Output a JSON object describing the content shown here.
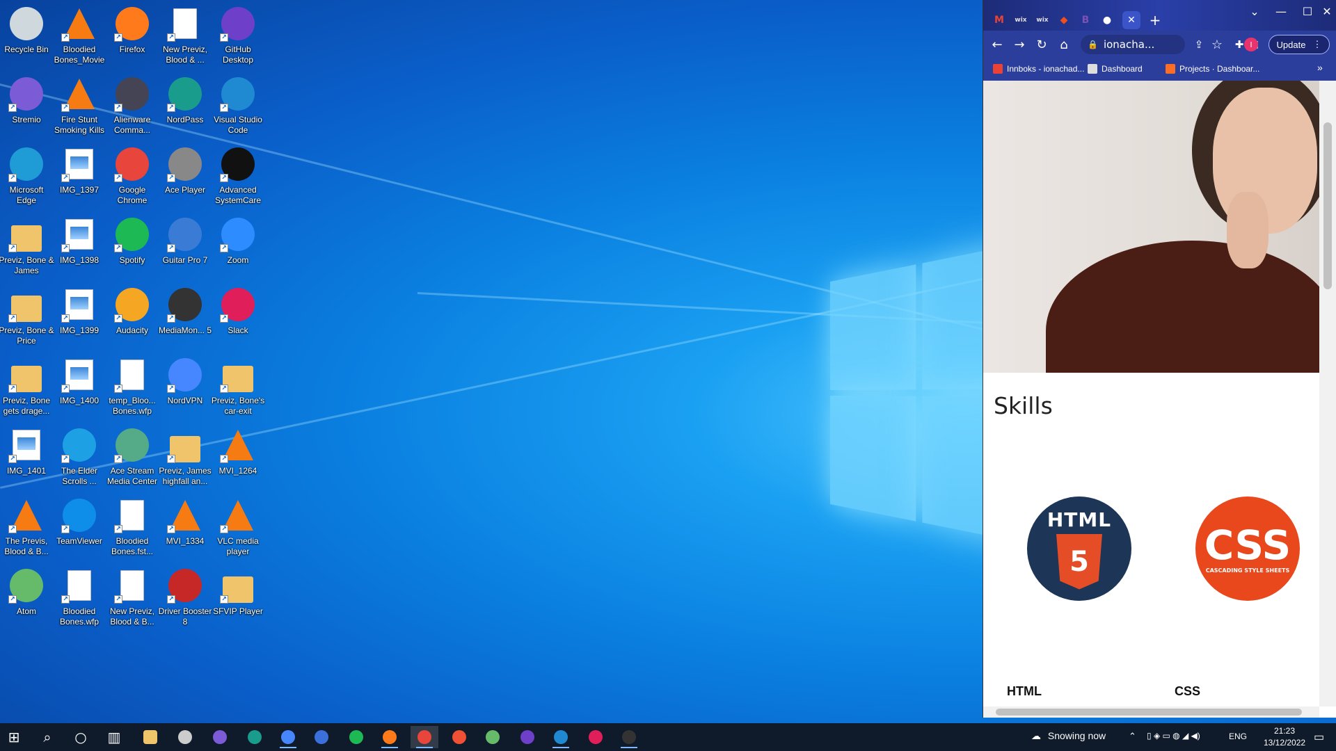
{
  "desktop": {
    "icons": [
      {
        "label": "Recycle Bin",
        "icon": "recycle-bin-icon"
      },
      {
        "label": "Bloodied Bones_Movie",
        "icon": "vlc-icon"
      },
      {
        "label": "Firefox",
        "icon": "firefox-icon"
      },
      {
        "label": "New Previz, Blood & ...",
        "icon": "file-icon"
      },
      {
        "label": "GitHub Desktop",
        "icon": "github-icon"
      },
      {
        "label": "Stremio",
        "icon": "stremio-icon"
      },
      {
        "label": "Fire Stunt Smoking Kills",
        "icon": "vlc-icon"
      },
      {
        "label": "Alienware Comma...",
        "icon": "alienware-icon"
      },
      {
        "label": "NordPass",
        "icon": "nordpass-icon"
      },
      {
        "label": "Visual Studio Code",
        "icon": "vscode-icon"
      },
      {
        "label": "Microsoft Edge",
        "icon": "edge-icon"
      },
      {
        "label": "IMG_1397",
        "icon": "image-file-icon"
      },
      {
        "label": "Google Chrome",
        "icon": "chrome-icon"
      },
      {
        "label": "Ace Player",
        "icon": "ace-player-icon"
      },
      {
        "label": "Advanced SystemCare",
        "icon": "advanced-systemcare-icon"
      },
      {
        "label": "Previz, Bone & James",
        "icon": "folder-icon"
      },
      {
        "label": "IMG_1398",
        "icon": "image-file-icon"
      },
      {
        "label": "Spotify",
        "icon": "spotify-icon"
      },
      {
        "label": "Guitar Pro 7",
        "icon": "guitar-pro-icon"
      },
      {
        "label": "Zoom",
        "icon": "zoom-icon"
      },
      {
        "label": "Previz, Bone & Price",
        "icon": "folder-icon"
      },
      {
        "label": "IMG_1399",
        "icon": "image-file-icon"
      },
      {
        "label": "Audacity",
        "icon": "audacity-icon"
      },
      {
        "label": "MediaMon... 5",
        "icon": "mediamonkey-icon"
      },
      {
        "label": "Slack",
        "icon": "slack-icon"
      },
      {
        "label": "Previz, Bone gets drage...",
        "icon": "folder-icon"
      },
      {
        "label": "IMG_1400",
        "icon": "image-file-icon"
      },
      {
        "label": "temp_Bloo... Bones.wfp",
        "icon": "file-icon"
      },
      {
        "label": "NordVPN",
        "icon": "nordvpn-icon"
      },
      {
        "label": "Previz, Bone's car-exit",
        "icon": "folder-icon"
      },
      {
        "label": "IMG_1401",
        "icon": "image-file-icon"
      },
      {
        "label": "The Elder Scrolls ...",
        "icon": "internet-explorer-icon"
      },
      {
        "label": "Ace Stream Media Center",
        "icon": "ace-stream-icon"
      },
      {
        "label": "Previz, James highfall an...",
        "icon": "folder-icon"
      },
      {
        "label": "MVI_1264",
        "icon": "vlc-icon"
      },
      {
        "label": "The Previs, Blood & B...",
        "icon": "vlc-icon"
      },
      {
        "label": "TeamViewer",
        "icon": "teamviewer-icon"
      },
      {
        "label": "Bloodied Bones.fst...",
        "icon": "file-icon"
      },
      {
        "label": "MVI_1334",
        "icon": "vlc-icon"
      },
      {
        "label": "VLC media player",
        "icon": "vlc-icon"
      },
      {
        "label": "Atom",
        "icon": "atom-icon"
      },
      {
        "label": "Bloodied Bones.wfp",
        "icon": "file-icon"
      },
      {
        "label": "New Previz, Blood & B...",
        "icon": "file-icon"
      },
      {
        "label": "Driver Booster 8",
        "icon": "driver-booster-icon"
      },
      {
        "label": "SFVIP Player",
        "icon": "folder-icon"
      }
    ]
  },
  "browser": {
    "tabs": [
      {
        "icon": "gmail-icon",
        "glyph": "M"
      },
      {
        "icon": "wix-icon",
        "glyph": "wix"
      },
      {
        "icon": "wix-icon",
        "glyph": "wix"
      },
      {
        "icon": "figma-icon",
        "glyph": "◆"
      },
      {
        "icon": "bootstrap-icon",
        "glyph": "B"
      },
      {
        "icon": "github-icon",
        "glyph": "●"
      }
    ],
    "new_tab_glyph": "+",
    "close_glyph": "✕",
    "url": "ionacha...",
    "update_label": "Update",
    "profile_initial": "I",
    "bookmarks": [
      {
        "label": "Innboks - ionachad...",
        "icon": "gmail-icon"
      },
      {
        "label": "Dashboard",
        "icon": "wix-icon"
      },
      {
        "label": "Projects · Dashboar...",
        "icon": "gitlab-icon"
      }
    ],
    "bookmarks_more": "»",
    "page": {
      "skills_heading": "Skills",
      "skills": [
        {
          "name": "HTML",
          "badge_text": "HTML",
          "badge_sub": "5"
        },
        {
          "name": "CSS",
          "badge_text": "CSS",
          "badge_sub": "CASCADING STYLE SHEETS"
        }
      ]
    }
  },
  "taskbar": {
    "weather": "Snowing now",
    "language": "ENG",
    "time": "21:23",
    "date": "13/12/2022",
    "apps": [
      "start-icon",
      "search-icon",
      "cortana-icon",
      "task-view-icon",
      "file-explorer-icon",
      "alienware-icon",
      "stremio-icon",
      "nordpass-icon",
      "nordvpn-icon",
      "vpn-shield-icon",
      "spotify-icon",
      "firefox-icon",
      "chrome-icon",
      "git-icon",
      "atom-icon",
      "github-icon",
      "vscode-icon",
      "slack-icon",
      "terminal-icon"
    ]
  },
  "colors": {
    "accent": "#0a7fe0",
    "browser_frame": "#2c3e9c",
    "html_badge": "#1d3557",
    "css_badge": "#e8481c"
  }
}
